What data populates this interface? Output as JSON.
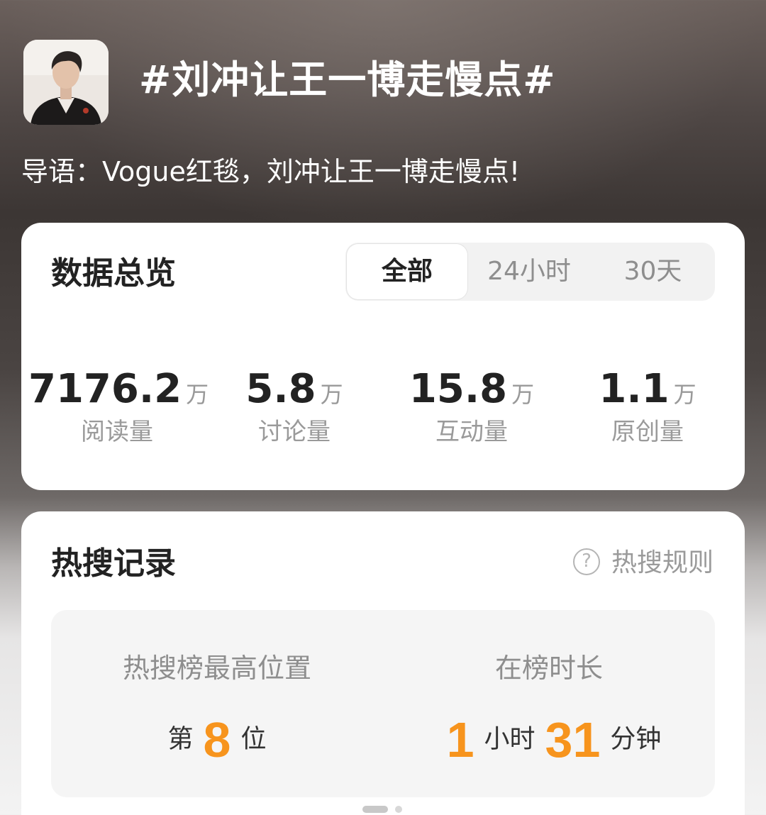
{
  "header": {
    "title": "#刘冲让王一博走慢点#",
    "intro_label": "导语：",
    "intro_text": "Vogue红毯，刘冲让王一博走慢点!"
  },
  "overview": {
    "title": "数据总览",
    "tabs": [
      {
        "label": "全部",
        "active": true
      },
      {
        "label": "24小时",
        "active": false
      },
      {
        "label": "30天",
        "active": false
      }
    ],
    "stats": [
      {
        "value": "7176.2",
        "unit": "万",
        "label": "阅读量"
      },
      {
        "value": "5.8",
        "unit": "万",
        "label": "讨论量"
      },
      {
        "value": "15.8",
        "unit": "万",
        "label": "互动量"
      },
      {
        "value": "1.1",
        "unit": "万",
        "label": "原创量"
      }
    ]
  },
  "hot_search": {
    "title": "热搜记录",
    "rule_icon": "question-circle-icon",
    "rule_label": "热搜规则",
    "peak": {
      "label": "热搜榜最高位置",
      "prefix": "第",
      "value": "8",
      "suffix": "位"
    },
    "duration": {
      "label": "在榜时长",
      "hours": "1",
      "hours_unit": "小时",
      "minutes": "31",
      "minutes_unit": "分钟"
    }
  },
  "colors": {
    "accent": "#f7941d",
    "card": "#ffffff",
    "muted_text": "#9a9a9a"
  }
}
